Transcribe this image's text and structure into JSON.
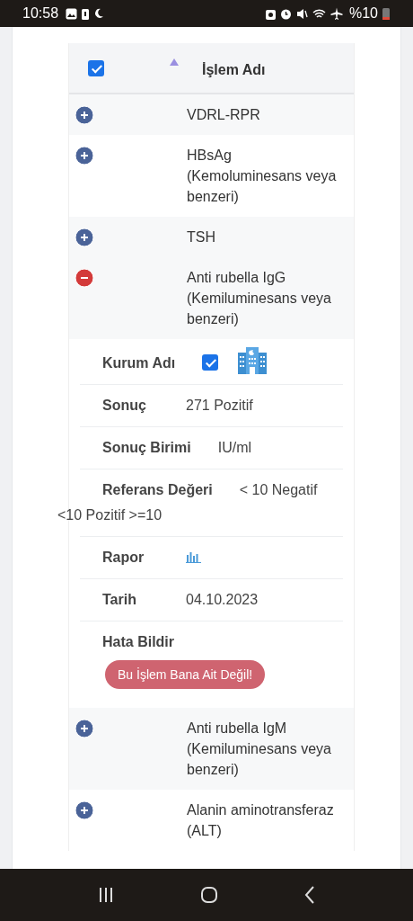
{
  "status_bar": {
    "time": "10:58",
    "battery": "%10"
  },
  "table": {
    "header": {
      "select_all_checked": true,
      "sort_ascending": true,
      "column": "İşlem Adı"
    },
    "rows": [
      {
        "name": "VDRL-RPR",
        "expanded": false
      },
      {
        "name": "HBsAg (Kemoluminesans veya benzeri)",
        "expanded": false
      },
      {
        "name": "TSH",
        "expanded": false
      },
      {
        "name": "Anti rubella IgG (Kemiluminesans veya benzeri)",
        "expanded": true,
        "details": [
          {
            "kind": "checkbox",
            "label": "Kurum Adı",
            "checked": true
          },
          {
            "kind": "text",
            "label": "Sonuç",
            "value": "271 Pozitif"
          },
          {
            "kind": "text",
            "label": "Sonuç Birimi",
            "value": "IU/ml"
          },
          {
            "kind": "text",
            "label": "Referans Değeri",
            "value": "< 10 Negatif",
            "continuation": "<10 Pozitif >=10"
          },
          {
            "kind": "chart",
            "label": "Rapor"
          },
          {
            "kind": "text",
            "label": "Tarih",
            "value": "04.10.2023"
          },
          {
            "kind": "button",
            "label": "Hata Bildir",
            "value": "Bu İşlem Bana Ait Değil!"
          }
        ]
      },
      {
        "name": "Anti rubella IgM (Kemiluminesans veya benzeri)",
        "expanded": false
      },
      {
        "name": "Alanin aminotransferaz (ALT)",
        "expanded": false
      }
    ]
  }
}
